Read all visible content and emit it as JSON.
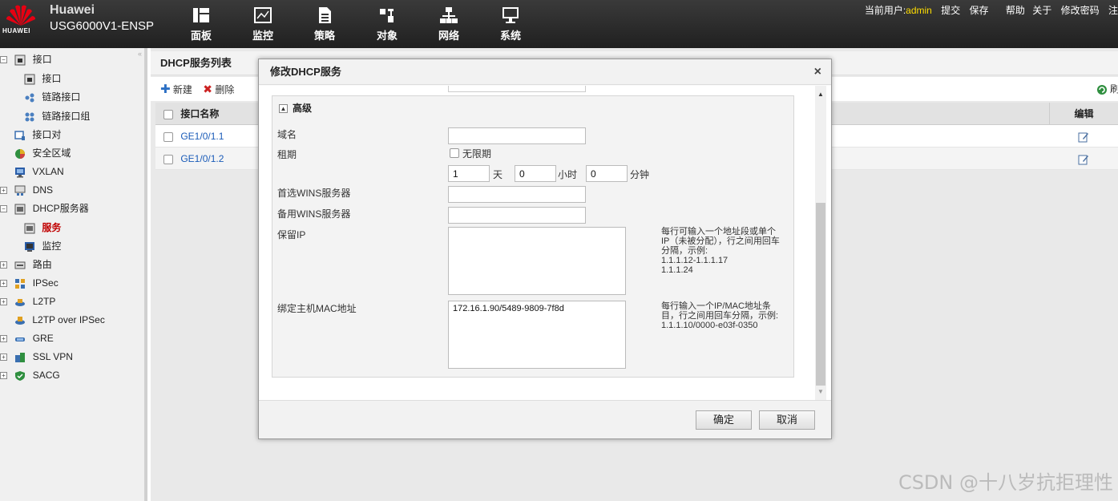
{
  "header": {
    "brand": "Huawei",
    "model": "USG6000V1-ENSP",
    "logo_text": "HUAWEI",
    "nav": [
      {
        "label": "面板",
        "icon": "dashboard-icon"
      },
      {
        "label": "监控",
        "icon": "monitor-chart-icon"
      },
      {
        "label": "策略",
        "icon": "policy-document-icon"
      },
      {
        "label": "对象",
        "icon": "object-icon"
      },
      {
        "label": "网络",
        "icon": "network-topology-icon"
      },
      {
        "label": "系统",
        "icon": "system-monitor-icon"
      }
    ],
    "current_user_label": "当前用户:",
    "current_user": "admin",
    "links": [
      "提交",
      "保存",
      "帮助",
      "关于",
      "修改密码",
      "注"
    ]
  },
  "sidebar": {
    "items": [
      {
        "label": "接口",
        "expander": "−",
        "icon": "interface-icon"
      },
      {
        "label": "接口",
        "icon": "interface-icon"
      },
      {
        "label": "链路接口",
        "icon": "link-interface-icon"
      },
      {
        "label": "链路接口组",
        "icon": "link-group-icon"
      },
      {
        "label": "接口对",
        "icon": "interface-pair-icon"
      },
      {
        "label": "安全区域",
        "icon": "security-zone-icon"
      },
      {
        "label": "VXLAN",
        "icon": "vxlan-icon"
      },
      {
        "label": "DNS",
        "expander": "+",
        "icon": "dns-icon"
      },
      {
        "label": "DHCP服务器",
        "expander": "−",
        "icon": "dhcp-server-icon"
      },
      {
        "label": "服务",
        "icon": "service-icon",
        "active": true
      },
      {
        "label": "监控",
        "icon": "monitor-icon"
      },
      {
        "label": "路由",
        "expander": "+",
        "icon": "route-icon"
      },
      {
        "label": "IPSec",
        "expander": "+",
        "icon": "ipsec-icon"
      },
      {
        "label": "L2TP",
        "expander": "+",
        "icon": "l2tp-icon"
      },
      {
        "label": "L2TP over IPSec",
        "icon": "l2tp-ipsec-icon"
      },
      {
        "label": "GRE",
        "expander": "+",
        "icon": "gre-icon"
      },
      {
        "label": "SSL VPN",
        "expander": "+",
        "icon": "ssl-vpn-icon"
      },
      {
        "label": "SACG",
        "expander": "+",
        "icon": "sacg-icon"
      }
    ]
  },
  "main": {
    "title": "DHCP服务列表",
    "toolbar": {
      "new_label": "新建",
      "delete_label": "删除",
      "refresh_label": "刷"
    },
    "table": {
      "columns": [
        "接口名称",
        "编辑"
      ],
      "rows": [
        {
          "name": "GE1/0/1.1"
        },
        {
          "name": "GE1/0/1.2"
        }
      ]
    }
  },
  "modal": {
    "title": "修改DHCP服务",
    "advanced_label": "高级",
    "fields": {
      "domain_label": "域名",
      "domain_value": "",
      "lease_label": "租期",
      "unlimited_label": "无限期",
      "lease_days": "1",
      "days_unit": "天",
      "lease_hours": "0",
      "hours_unit": "小时",
      "lease_minutes": "0",
      "minutes_unit": "分钟",
      "primary_wins_label": "首选WINS服务器",
      "primary_wins_value": "",
      "backup_wins_label": "备用WINS服务器",
      "backup_wins_value": "",
      "reserved_ip_label": "保留IP",
      "reserved_ip_value": "",
      "reserved_ip_hint": "每行可输入一个地址段或单个IP（未被分配），行之间用回车分隔，示例:\n1.1.1.12-1.1.1.17\n1.1.1.24",
      "bind_mac_label": "绑定主机MAC地址",
      "bind_mac_value": "172.16.1.90/5489-9809-7f8d",
      "bind_mac_hint": "每行输入一个IP/MAC地址条目，行之间用回车分隔，示例:\n1.1.1.10/0000-e03f-0350"
    },
    "ok_label": "确定",
    "cancel_label": "取消"
  },
  "watermark": "CSDN @十八岁抗拒理性",
  "colors": {
    "topbar": "#2b2b2b",
    "user": "#ffdd00",
    "link": "#1a5bb8",
    "active": "#c00000"
  }
}
